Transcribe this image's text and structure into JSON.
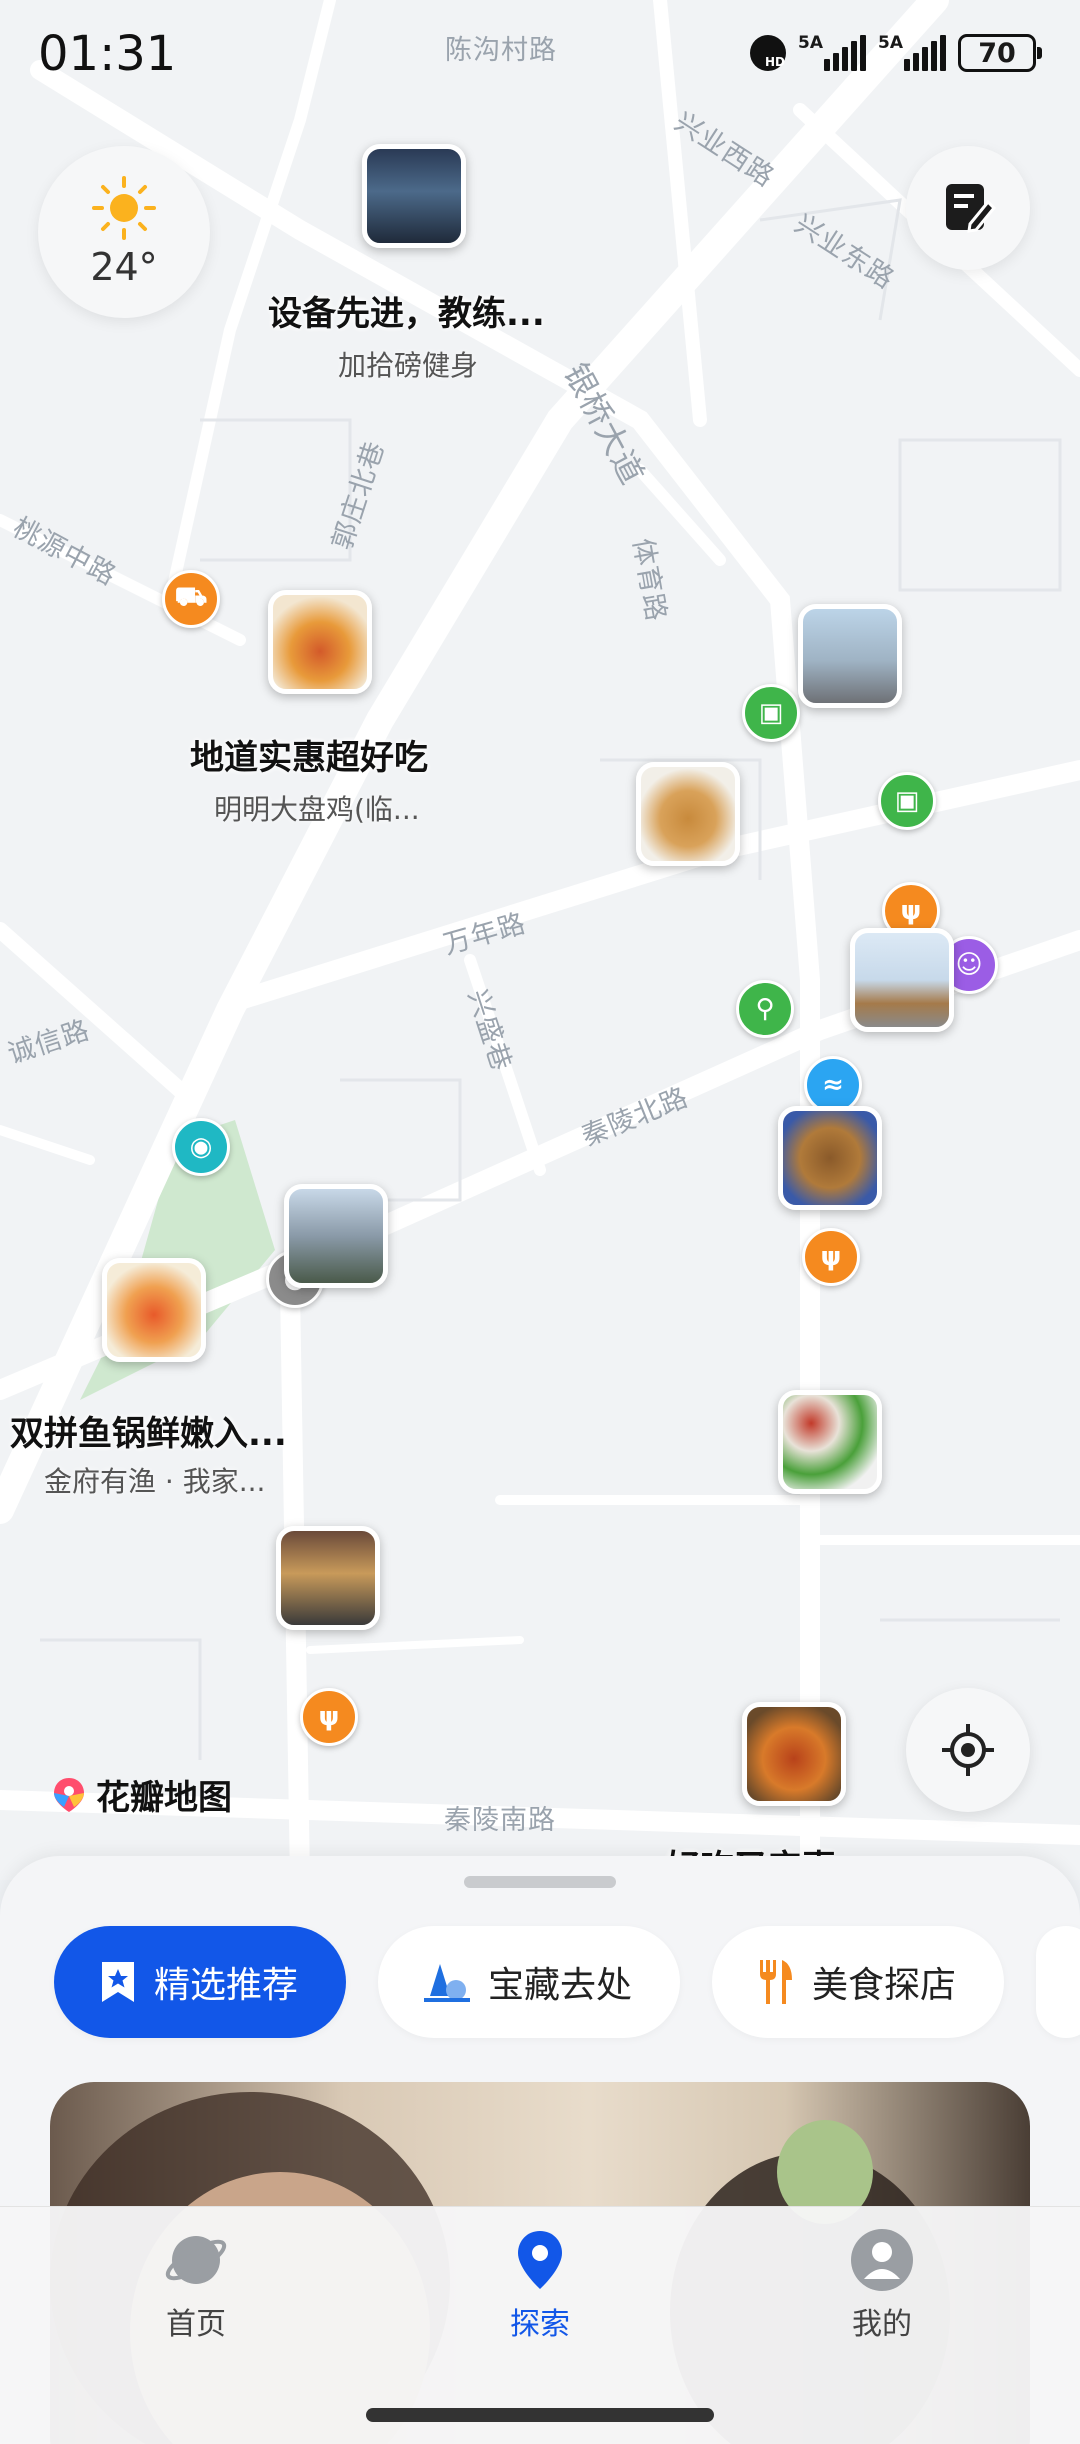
{
  "status": {
    "time": "01:31",
    "sim1": "5A",
    "sim2": "5A",
    "battery": "70"
  },
  "weather": {
    "temperature": "24°"
  },
  "roads": [
    {
      "id": "chengou",
      "name": "陈沟村路"
    },
    {
      "id": "xingyexi",
      "name": "兴业西路"
    },
    {
      "id": "xingyedong",
      "name": "兴业东路"
    },
    {
      "id": "yinqiao",
      "name": "银桥大道"
    },
    {
      "id": "guozhuang",
      "name": "郭庄北巷"
    },
    {
      "id": "taoyuan",
      "name": "桃源中路"
    },
    {
      "id": "tiyu",
      "name": "体育路"
    },
    {
      "id": "wannian",
      "name": "万年路"
    },
    {
      "id": "xingsheng",
      "name": "兴盛巷"
    },
    {
      "id": "chengxin",
      "name": "诚信路"
    },
    {
      "id": "qinlingbei",
      "name": "秦陵北路"
    },
    {
      "id": "qinlingnan",
      "name": "秦陵南路"
    }
  ],
  "pois": [
    {
      "title": "设备先进，教练...",
      "subtitle": "加拾磅健身"
    },
    {
      "title": "地道实惠超好吃",
      "subtitle": "明明大盘鸡(临..."
    },
    {
      "title": "双拼鱼锅鲜嫩入...",
      "subtitle": "金府有渔 · 我家..."
    },
    {
      "title": "好吃又实惠..."
    }
  ],
  "map_logo": "花瓣地图",
  "chips": [
    {
      "label": "精选推荐",
      "icon": "bookmark-star-icon"
    },
    {
      "label": "宝藏去处",
      "icon": "tree-icon"
    },
    {
      "label": "美食探店",
      "icon": "fork-knife-icon"
    }
  ],
  "nav": {
    "items": [
      {
        "label": "首页",
        "icon": "planet-icon"
      },
      {
        "label": "探索",
        "icon": "location-pin-icon"
      },
      {
        "label": "我的",
        "icon": "user-icon"
      }
    ]
  },
  "colors": {
    "accent": "#1257e8",
    "map_bg": "#f1f3f5",
    "road": "#ffffff",
    "park": "#cfe8cf"
  }
}
